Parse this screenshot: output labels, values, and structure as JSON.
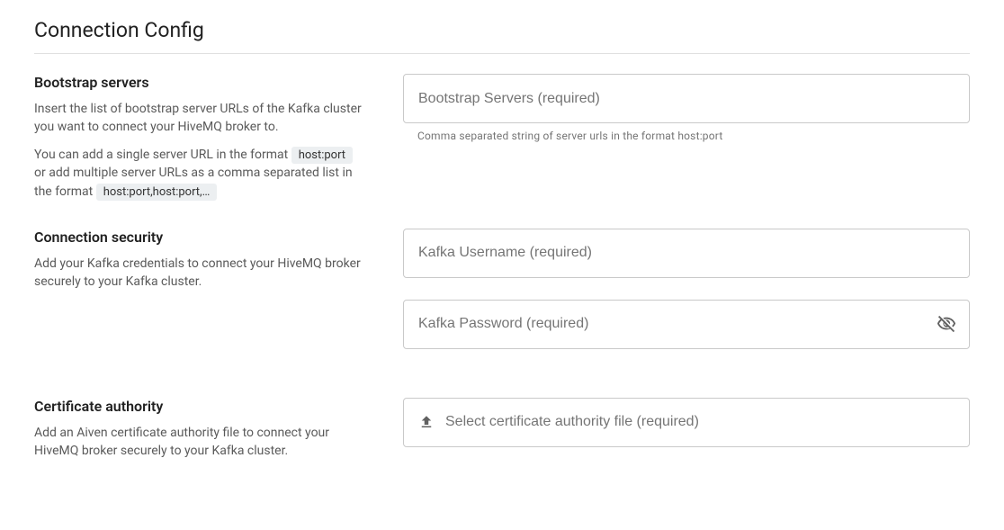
{
  "title": "Connection Config",
  "bootstrap": {
    "heading": "Bootstrap servers",
    "desc1": "Insert the list of bootstrap server URLs of the Kafka cluster you want to connect your HiveMQ broker to.",
    "desc2a": "You can add a single server URL in the format ",
    "code1": "host:port",
    "desc2b": " or add multiple server URLs as a comma separated list in the format ",
    "code2": "host:port,host:port,…",
    "placeholder": "Bootstrap Servers (required)",
    "hint": "Comma separated string of server urls in the format host:port"
  },
  "security": {
    "heading": "Connection security",
    "desc": "Add your Kafka credentials to connect your HiveMQ broker securely to your Kafka cluster.",
    "username_placeholder": "Kafka Username (required)",
    "password_placeholder": "Kafka Password (required)"
  },
  "cert": {
    "heading": "Certificate authority",
    "desc": "Add an Aiven certificate authority file to connect your HiveMQ broker securely to your Kafka cluster.",
    "button_label": "Select certificate authority file (required)"
  }
}
